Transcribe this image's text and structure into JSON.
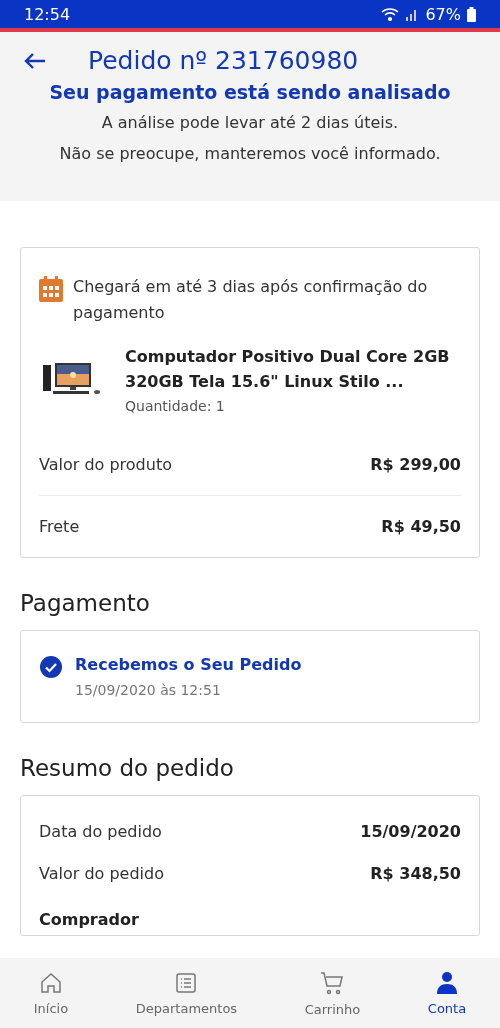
{
  "status_bar": {
    "time": "12:54",
    "battery": "67%"
  },
  "header": {
    "title": "Pedido nº 231760980"
  },
  "notice": {
    "title": "Seu pagamento está sendo analisado",
    "lines": [
      "A análise pode levar até 2 dias úteis.",
      "Não se preocupe, manteremos você informado."
    ]
  },
  "delivery": {
    "message": "Chegará em até 3 dias após confirmação do pagamento",
    "product": {
      "name": "Computador Positivo Dual Core 2GB 320GB Tela 15.6\" Linux Stilo ...",
      "quantity": "Quantidade: 1"
    },
    "rows": [
      {
        "label": "Valor do produto",
        "value": "R$ 299,00"
      },
      {
        "label": "Frete",
        "value": "R$ 49,50"
      }
    ]
  },
  "payment": {
    "heading": "Pagamento",
    "status": "Recebemos o Seu Pedido",
    "date": "15/09/2020 às 12:51",
    "confirmed": true
  },
  "summary": {
    "heading": "Resumo do pedido",
    "rows": [
      {
        "label": "Data do pedido",
        "value": "15/09/2020"
      },
      {
        "label": "Valor do pedido",
        "value": "R$ 348,50"
      }
    ],
    "section": "Comprador"
  },
  "nav": [
    {
      "kind": "home",
      "label": "Início",
      "selected": false
    },
    {
      "kind": "list",
      "label": "Departamentos",
      "selected": false
    },
    {
      "kind": "cart",
      "label": "Carrinho",
      "selected": false
    },
    {
      "kind": "user",
      "label": "Conta",
      "selected": true
    }
  ]
}
